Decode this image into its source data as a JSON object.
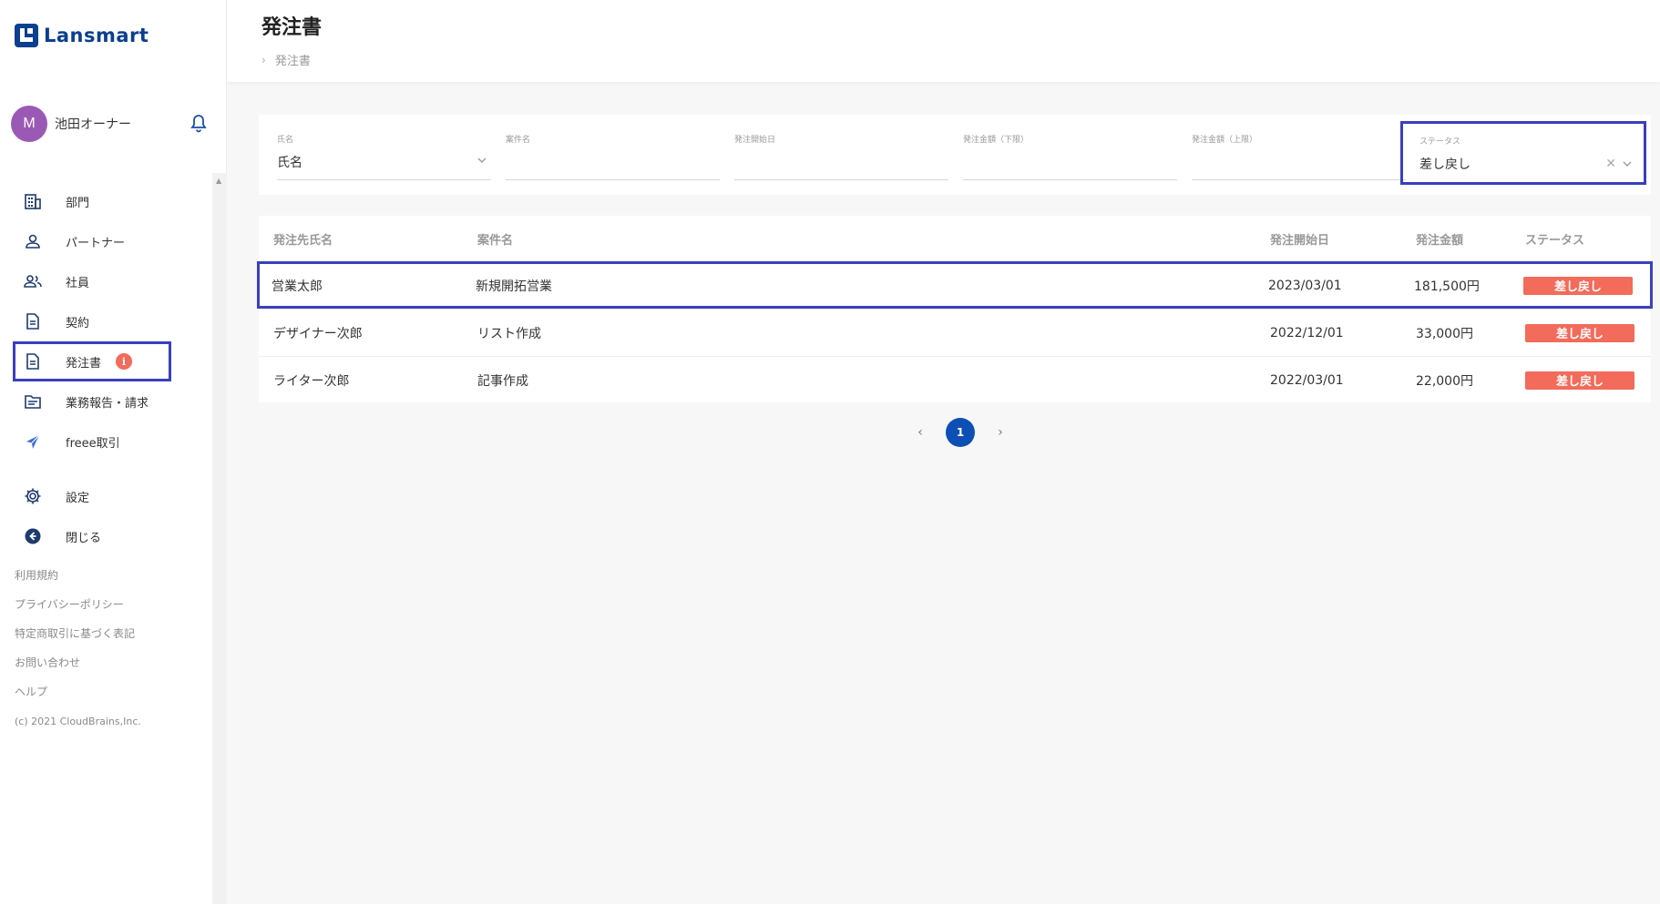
{
  "brand": {
    "name": "Lansmart",
    "color": "#0d3f8f"
  },
  "user": {
    "initial": "M",
    "name": "池田オーナー",
    "avatar_color": "#9b59b6"
  },
  "nav": {
    "items": [
      {
        "label": "部門",
        "icon": "building-icon"
      },
      {
        "label": "パートナー",
        "icon": "person-icon"
      },
      {
        "label": "社員",
        "icon": "people-icon"
      },
      {
        "label": "契約",
        "icon": "document-icon"
      },
      {
        "label": "発注書",
        "icon": "document-icon",
        "badge": "i",
        "active": true
      },
      {
        "label": "業務報告・請求",
        "icon": "folder-icon"
      },
      {
        "label": "freee取引",
        "icon": "freee-icon"
      },
      {
        "label": "設定",
        "icon": "gear-icon"
      },
      {
        "label": "閉じる",
        "icon": "arrow-left-circle-icon"
      }
    ]
  },
  "footer": {
    "links": [
      "利用規約",
      "プライバシーポリシー",
      "特定商取引に基づく表記",
      "お問い合わせ",
      "ヘルプ"
    ],
    "copyright": "(c) 2021 CloudBrains,Inc."
  },
  "header": {
    "title": "発注書",
    "breadcrumb": "発注書"
  },
  "filters": {
    "name": {
      "label": "氏名",
      "value": "氏名"
    },
    "project": {
      "label": "案件名",
      "value": ""
    },
    "start_date": {
      "label": "発注開始日",
      "value": ""
    },
    "amount_min": {
      "label": "発注金額（下限）",
      "value": ""
    },
    "amount_max": {
      "label": "発注金額（上限）",
      "value": ""
    },
    "status": {
      "label": "ステータス",
      "value": "差し戻し"
    }
  },
  "table": {
    "headers": {
      "name": "発注先氏名",
      "project": "案件名",
      "date": "発注開始日",
      "amount": "発注金額",
      "status": "ステータス"
    },
    "rows": [
      {
        "name": "営業太郎",
        "project": "新規開拓営業",
        "date": "2023/03/01",
        "amount": "181,500円",
        "status": "差し戻し"
      },
      {
        "name": "デザイナー次郎",
        "project": "リスト作成",
        "date": "2022/12/01",
        "amount": "33,000円",
        "status": "差し戻し"
      },
      {
        "name": "ライター次郎",
        "project": "記事作成",
        "date": "2022/03/01",
        "amount": "22,000円",
        "status": "差し戻し"
      }
    ]
  },
  "pagination": {
    "current": "1",
    "prev": "‹",
    "next": "›"
  },
  "colors": {
    "accent": "#0d4fb5",
    "status_returned": "#f26b5b",
    "highlight": "#3a3fbf"
  }
}
